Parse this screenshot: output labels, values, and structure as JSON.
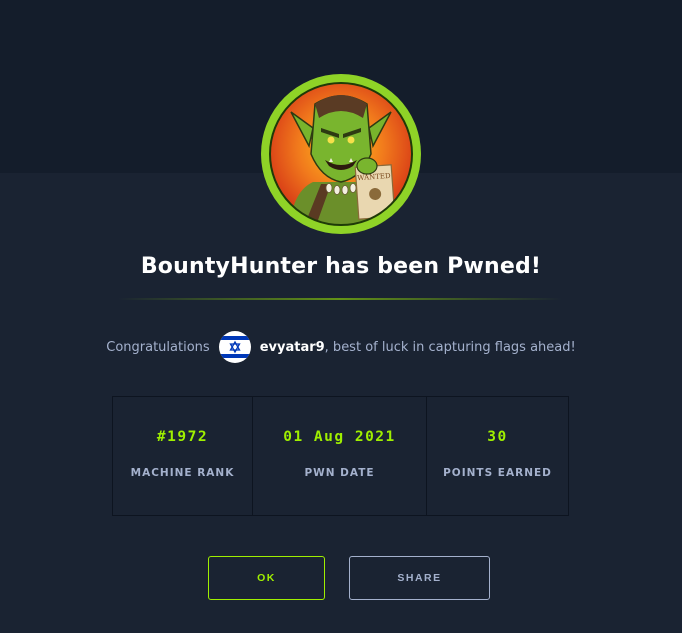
{
  "header": {
    "avatar_icon": "goblin-bounty-hunter-avatar",
    "title": "BountyHunter has been Pwned!"
  },
  "congrats": {
    "prefix": "Congratulations",
    "flag_icon": "israel-flag-icon",
    "username": "evyatar9",
    "suffix": ", best of luck in capturing flags ahead!"
  },
  "stats": [
    {
      "value": "#1972",
      "label": "MACHINE RANK"
    },
    {
      "value": "01 Aug 2021",
      "label": "PWN DATE"
    },
    {
      "value": "30",
      "label": "POINTS EARNED"
    }
  ],
  "buttons": {
    "ok_label": "OK",
    "share_label": "SHARE"
  },
  "colors": {
    "accent": "#9fef00",
    "background": "#1a2332",
    "header_band": "#141d2b",
    "muted_text": "#a4b1cd"
  }
}
